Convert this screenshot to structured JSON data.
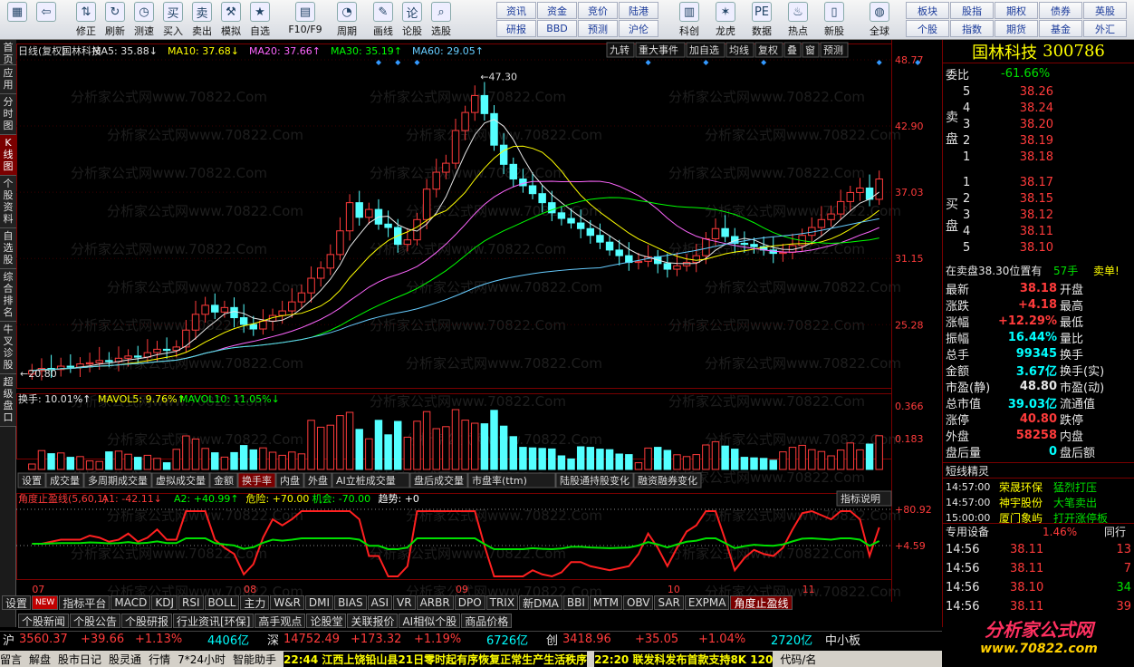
{
  "toolbar": {
    "buttons": [
      {
        "name": "exit-button",
        "label": "",
        "icon": "home-grid-icon"
      },
      {
        "name": "back-button",
        "label": "",
        "icon": "arrow-left-icon"
      },
      {
        "name": "modify-button",
        "label": "修正",
        "icon": "arrow-up-down-icon"
      },
      {
        "name": "refresh-button",
        "label": "刷新",
        "icon": "refresh-icon"
      },
      {
        "name": "test-button",
        "label": "测速",
        "icon": "clock-icon"
      },
      {
        "name": "buy-button",
        "label": "买入",
        "icon": "buy-icon"
      },
      {
        "name": "sell-button",
        "label": "卖出",
        "icon": "sell-icon"
      },
      {
        "name": "simulate-button",
        "label": "模拟",
        "icon": "hammer-icon"
      },
      {
        "name": "watchlist-button",
        "label": "自选",
        "icon": "star-icon"
      },
      {
        "name": "f10-button",
        "label": "F10/F9",
        "icon": "f10-icon"
      },
      {
        "name": "period-button",
        "label": "周期",
        "icon": "period-icon"
      },
      {
        "name": "draw-button",
        "label": "画线",
        "icon": "pencil-icon"
      },
      {
        "name": "discuss-button",
        "label": "论股",
        "icon": "discuss-icon"
      },
      {
        "name": "stock-pick-button",
        "label": "选股",
        "icon": "search-chart-icon"
      }
    ],
    "grid1": [
      "资讯",
      "资金",
      "竞价",
      "陆港",
      "研报",
      "BBD",
      "预测",
      "沪伦"
    ],
    "buttons2": [
      {
        "name": "kc-button",
        "label": "科创",
        "icon": "chart-icon"
      },
      {
        "name": "dragon-button",
        "label": "龙虎",
        "icon": "tiger-icon"
      },
      {
        "name": "data-button",
        "label": "数据",
        "icon": "pe-icon"
      },
      {
        "name": "hot-button",
        "label": "热点",
        "icon": "hot-icon"
      },
      {
        "name": "newboard-button",
        "label": "新股",
        "icon": "phone-icon"
      },
      {
        "name": "global-button",
        "label": "全球",
        "icon": "globe-icon"
      }
    ],
    "grid2": [
      "板块",
      "股指",
      "期权",
      "债券",
      "英股",
      "个股",
      "指数",
      "期货",
      "基金",
      "外汇"
    ]
  },
  "sidebar": [
    "首页",
    "应用",
    "分时图",
    "K线图",
    "个股资料",
    "自选股",
    "综合排名",
    "牛叉诊股",
    "超级盘口"
  ],
  "chart": {
    "header": {
      "period": "日线(复权)",
      "name": "国林科技",
      "ma5": "MA5: 35.88↓",
      "ma10": "MA10: 37.68↓",
      "ma20": "MA20: 37.66↑",
      "ma30": "MA30: 35.19↑",
      "ma60": "MA60: 29.05↑"
    },
    "right_buttons": [
      "九转",
      "重大事件",
      "加自选",
      "均线",
      "复权",
      "叠",
      "窗",
      "预测"
    ],
    "price_labels": [
      "48.77",
      "42.90",
      "37.03",
      "31.15",
      "25.28"
    ],
    "high_label": "47.30",
    "low_label": "20.80",
    "vol_header": {
      "hs": "换手: 10.01%↑",
      "mav5": "MAVOL5: 9.76%↑",
      "mav10": "MAVOL10: 11.05%↓"
    },
    "vol_labels": [
      "0.366",
      "0.183"
    ],
    "vol_tabs": [
      "设置",
      "成交量",
      "多周期成交量",
      "虚拟成交量",
      "金额",
      "换手率",
      "内盘",
      "外盘",
      "AI立桩成交量",
      "盘后成交量",
      "市盘率(ttm)",
      "陆股通持股变化",
      "融资融券变化"
    ],
    "ind_header": {
      "name": "角度止盈线(5,60,1)",
      "a1": "A1: -42.11↓",
      "a2": "A2: +40.99↑",
      "risk": "危险: +70.00",
      "chance": "机会: -70.00",
      "trend": "趋势: +0"
    },
    "ind_button": "指标说明",
    "ind_labels": [
      "+80.92",
      "+4.59"
    ],
    "months": [
      "07",
      "08",
      "09",
      "10",
      "11"
    ],
    "watermark": "分析家公式网www.70822.Com"
  },
  "chart_data": {
    "type": "candlestick",
    "series": [
      {
        "name": "price",
        "values": [
          21.2,
          21.4,
          21.3,
          21.6,
          21.5,
          21.8,
          21.9,
          22.1,
          22.0,
          22.3,
          22.5,
          22.4,
          22.8,
          23.1,
          23.0,
          23.3,
          24.8,
          26.2,
          27.0,
          26.4,
          26.8,
          25.9,
          25.3,
          24.9,
          25.6,
          26.1,
          26.5,
          27.3,
          28.1,
          29.4,
          30.3,
          31.5,
          33.6,
          36.1,
          34.8,
          35.5,
          34.2,
          33.9,
          32.4,
          32.8,
          34.6,
          37.3,
          38.8,
          39.6,
          42.5,
          44.1,
          45.6,
          44.0,
          41.2,
          39.5,
          38.2,
          37.6,
          36.9,
          36.1,
          35.2,
          34.7,
          34.3,
          33.8,
          33.2,
          32.6,
          31.9,
          31.4,
          30.8,
          30.9,
          31.3,
          30.7,
          30.2,
          30.5,
          30.8,
          31.4,
          32.9,
          33.8,
          33.1,
          32.5,
          32.4,
          32.2,
          31.9,
          31.6,
          31.7,
          32.3,
          33.2,
          33.9,
          34.6,
          35.1,
          36.2,
          37.0,
          37.4,
          36.4,
          38.2
        ]
      },
      {
        "name": "MA5",
        "values": [
          35.88
        ]
      },
      {
        "name": "MA10",
        "values": [
          37.68
        ]
      },
      {
        "name": "MA20",
        "values": [
          37.66
        ]
      },
      {
        "name": "MA30",
        "values": [
          35.19
        ]
      },
      {
        "name": "MA60",
        "values": [
          29.05
        ]
      }
    ],
    "ylim": [
      20.8,
      48.77
    ],
    "x": [
      "07",
      "08",
      "09",
      "10",
      "11"
    ]
  },
  "quote": {
    "title": "国林科技",
    "code": "300786",
    "weibi_label": "委比",
    "weibi": "-61.66%",
    "sell_label": "卖盘",
    "buy_label": "买盘",
    "asks": [
      {
        "n": "5",
        "p": "38.26"
      },
      {
        "n": "4",
        "p": "38.24"
      },
      {
        "n": "3",
        "p": "38.20"
      },
      {
        "n": "2",
        "p": "38.19"
      },
      {
        "n": "1",
        "p": "38.18"
      }
    ],
    "bids": [
      {
        "n": "1",
        "p": "38.17"
      },
      {
        "n": "2",
        "p": "38.15"
      },
      {
        "n": "3",
        "p": "38.12"
      },
      {
        "n": "4",
        "p": "38.11"
      },
      {
        "n": "5",
        "p": "38.10"
      }
    ],
    "order_line": {
      "text": "在卖盘38.30位置有",
      "qty": "57手",
      "action": "卖单!"
    },
    "stats": [
      {
        "l": "最新",
        "v": "38.18",
        "r": "开盘",
        "c": "red"
      },
      {
        "l": "涨跌",
        "v": "+4.18",
        "r": "最高",
        "c": "red"
      },
      {
        "l": "涨幅",
        "v": "+12.29%",
        "r": "最低",
        "c": "red"
      },
      {
        "l": "振幅",
        "v": "16.44%",
        "r": "量比",
        "c": "cyan"
      },
      {
        "l": "总手",
        "v": "99345",
        "r": "换手",
        "c": "cyan"
      },
      {
        "l": "金额",
        "v": "3.67亿",
        "r": "换手(实)",
        "c": "cyan"
      },
      {
        "l": "市盈(静)",
        "v": "48.80",
        "r": "市盈(动)",
        "c": "white"
      },
      {
        "l": "总市值",
        "v": "39.03亿",
        "r": "流通值",
        "c": "cyan"
      },
      {
        "l": "涨停",
        "v": "40.80",
        "r": "跌停",
        "c": "red"
      },
      {
        "l": "外盘",
        "v": "58258",
        "r": "内盘",
        "c": "red"
      },
      {
        "l": "盘后量",
        "v": "0",
        "r": "盘后额",
        "c": "cyan"
      }
    ],
    "short_title": "短线精灵",
    "short": [
      {
        "t": "14:57:00",
        "n": "荣晟环保",
        "e": "猛烈打压"
      },
      {
        "t": "14:57:00",
        "n": "神宇股份",
        "e": "大笔卖出"
      },
      {
        "t": "15:00:00",
        "n": "厦门象屿",
        "e": "打开涨停板"
      }
    ],
    "device": {
      "label": "专用设备",
      "pct": "1.46%",
      "tail": "同行"
    },
    "ticks": [
      {
        "t": "14:56",
        "p": "38.11",
        "v": "13"
      },
      {
        "t": "14:56",
        "p": "38.11",
        "v": "7"
      },
      {
        "t": "14:56",
        "p": "38.10",
        "v": "34"
      },
      {
        "t": "14:56",
        "p": "38.11",
        "v": "39"
      }
    ]
  },
  "bottom": {
    "tabs1": [
      "设置",
      "NEW",
      "指标平台",
      "MACD",
      "KDJ",
      "RSI",
      "BOLL",
      "主力",
      "W&R",
      "DMI",
      "BIAS",
      "ASI",
      "VR",
      "ARBR",
      "DPO",
      "TRIX",
      "新DMA",
      "BBI",
      "MTM",
      "OBV",
      "SAR",
      "EXPMA",
      "角度止盈线"
    ],
    "tabs2": [
      "个股新闻",
      "个股公告",
      "个股研报",
      "行业资讯[环保]",
      "高手观点",
      "论股堂",
      "关联报价",
      "AI相似个股",
      "商品价格"
    ],
    "index": {
      "sh": "沪",
      "sh_v": "3560.37",
      "sh_c": "+39.66",
      "sh_p": "+1.13%",
      "sh_a": "4406亿",
      "sz": "深",
      "sz_v": "14752.49",
      "sz_c": "+173.32",
      "sz_p": "+1.19%",
      "sz_a": "6726亿",
      "cy": "创",
      "cy_v": "3418.96",
      "cy_c": "+35.05",
      "cy_p": "+1.04%",
      "cy_a": "2720亿",
      "zx": "中小板"
    },
    "ticker": [
      "留言",
      "解盘",
      "股市日记",
      "股灵通",
      "行情",
      "7*24小时",
      "智能助手",
      "22:44 江西上饶铅山县21日零时起有序恢复正常生产生活秩序",
      "22:20 联发科发布首款支持8K 120",
      "代码/名"
    ],
    "brand": "分析家公式网",
    "brand_url": "www.70822.com"
  }
}
